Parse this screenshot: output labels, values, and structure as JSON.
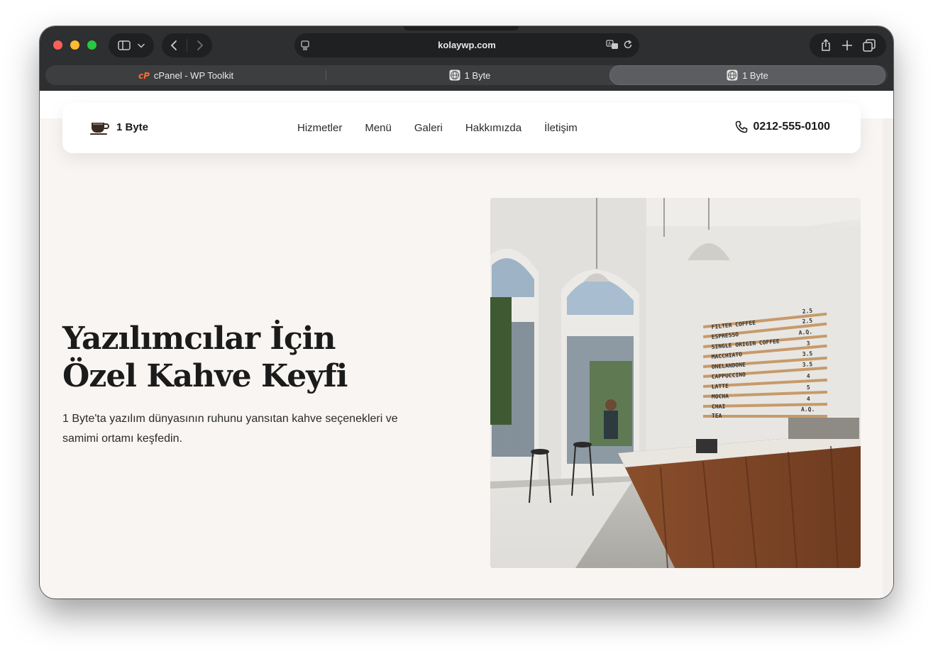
{
  "browser": {
    "url": "kolaywp.com",
    "tabs": [
      {
        "title": "cPanel - WP Toolkit",
        "icon": "cpanel-icon"
      },
      {
        "title": "1 Byte",
        "icon": "globe-icon"
      },
      {
        "title": "1 Byte",
        "icon": "globe-icon",
        "active": true
      }
    ]
  },
  "site": {
    "brand": "1 Byte",
    "nav": [
      "Hizmetler",
      "Menü",
      "Galeri",
      "Hakkımızda",
      "İletişim"
    ],
    "phone": "0212-555-0100",
    "hero": {
      "title_line1": "Yazılımcılar İçin",
      "title_line2": "Özel Kahve Keyfi",
      "subtitle": "1 Byte'ta yazılım dünyasının ruhunu yansıtan kahve seçenekleri ve samimi ortamı keşfedin."
    },
    "image": {
      "menu_board": [
        {
          "item": "FILTER COFFEE",
          "price": "2.5"
        },
        {
          "item": "ESPRESSO",
          "price": "2.5"
        },
        {
          "item": "SINGLE ORIGIN COFFEE",
          "price": "A.Q."
        },
        {
          "item": "MACCHIATO",
          "price": "3"
        },
        {
          "item": "ONELANDONE",
          "price": "3.5"
        },
        {
          "item": "CAPPUCCINO",
          "price": "3.5"
        },
        {
          "item": "LATTE",
          "price": "4"
        },
        {
          "item": "MOCHA",
          "price": "5"
        },
        {
          "item": "CHAI",
          "price": "4"
        },
        {
          "item": "TEA",
          "price": "A.Q."
        }
      ]
    }
  },
  "colors": {
    "page_bg": "#f8f5f2",
    "titlebar": "#2d2f31",
    "text": "#1b1b1b"
  }
}
